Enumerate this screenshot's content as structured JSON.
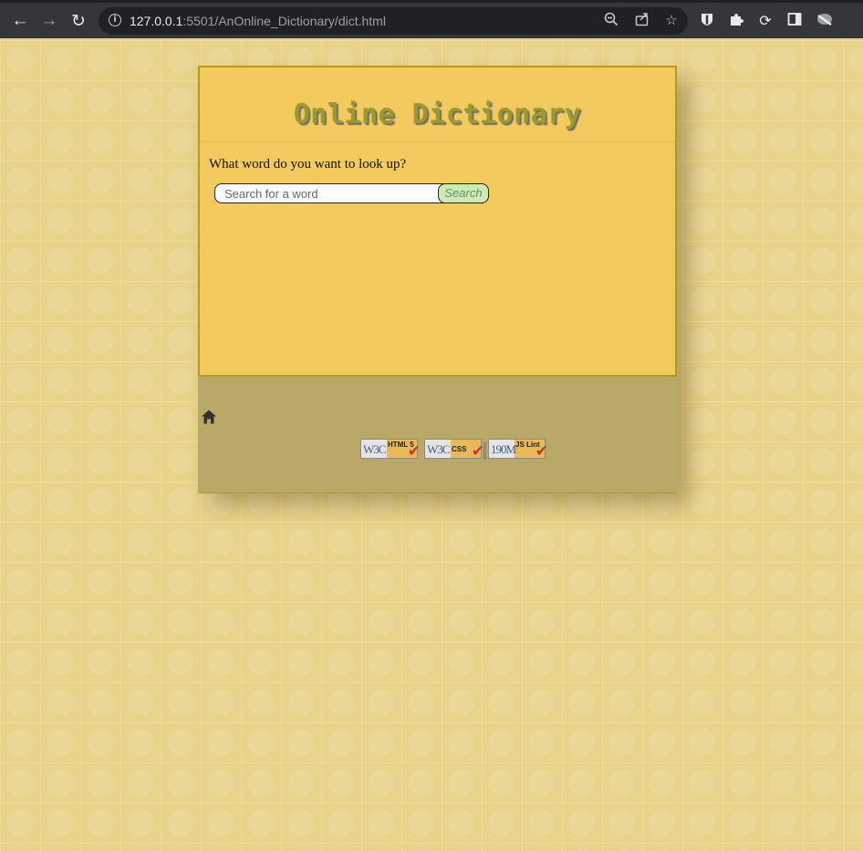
{
  "browser": {
    "url_host": "127.0.0.1",
    "url_rest": ":5501/AnOnline_Dictionary/dict.html",
    "icons": [
      "back-icon",
      "forward-icon",
      "reload-icon",
      "info-icon",
      "zoom-out-icon",
      "share-icon",
      "star-icon",
      "shield-extension-icon",
      "puzzle-extension-icon",
      "sync-extension-icon",
      "sidepanel-icon",
      "profile-icon"
    ]
  },
  "page": {
    "title": "Online Dictionary",
    "prompt": "What word do you want to look up?",
    "search": {
      "placeholder": "Search for a word",
      "value": "",
      "button_label": "Search"
    }
  },
  "footer": {
    "home_icon": "home-icon",
    "badges": [
      {
        "left": "W3C",
        "right": "HTML 5"
      },
      {
        "left": "W3C",
        "right": "CSS"
      },
      {
        "left": "190M",
        "right": "JS Lint"
      }
    ]
  },
  "colors": {
    "main_bg": "#f2ca5e",
    "footer_bg": "#b9a968",
    "title": "#9c9a2e",
    "search_button_bg": "#cdeab2"
  }
}
